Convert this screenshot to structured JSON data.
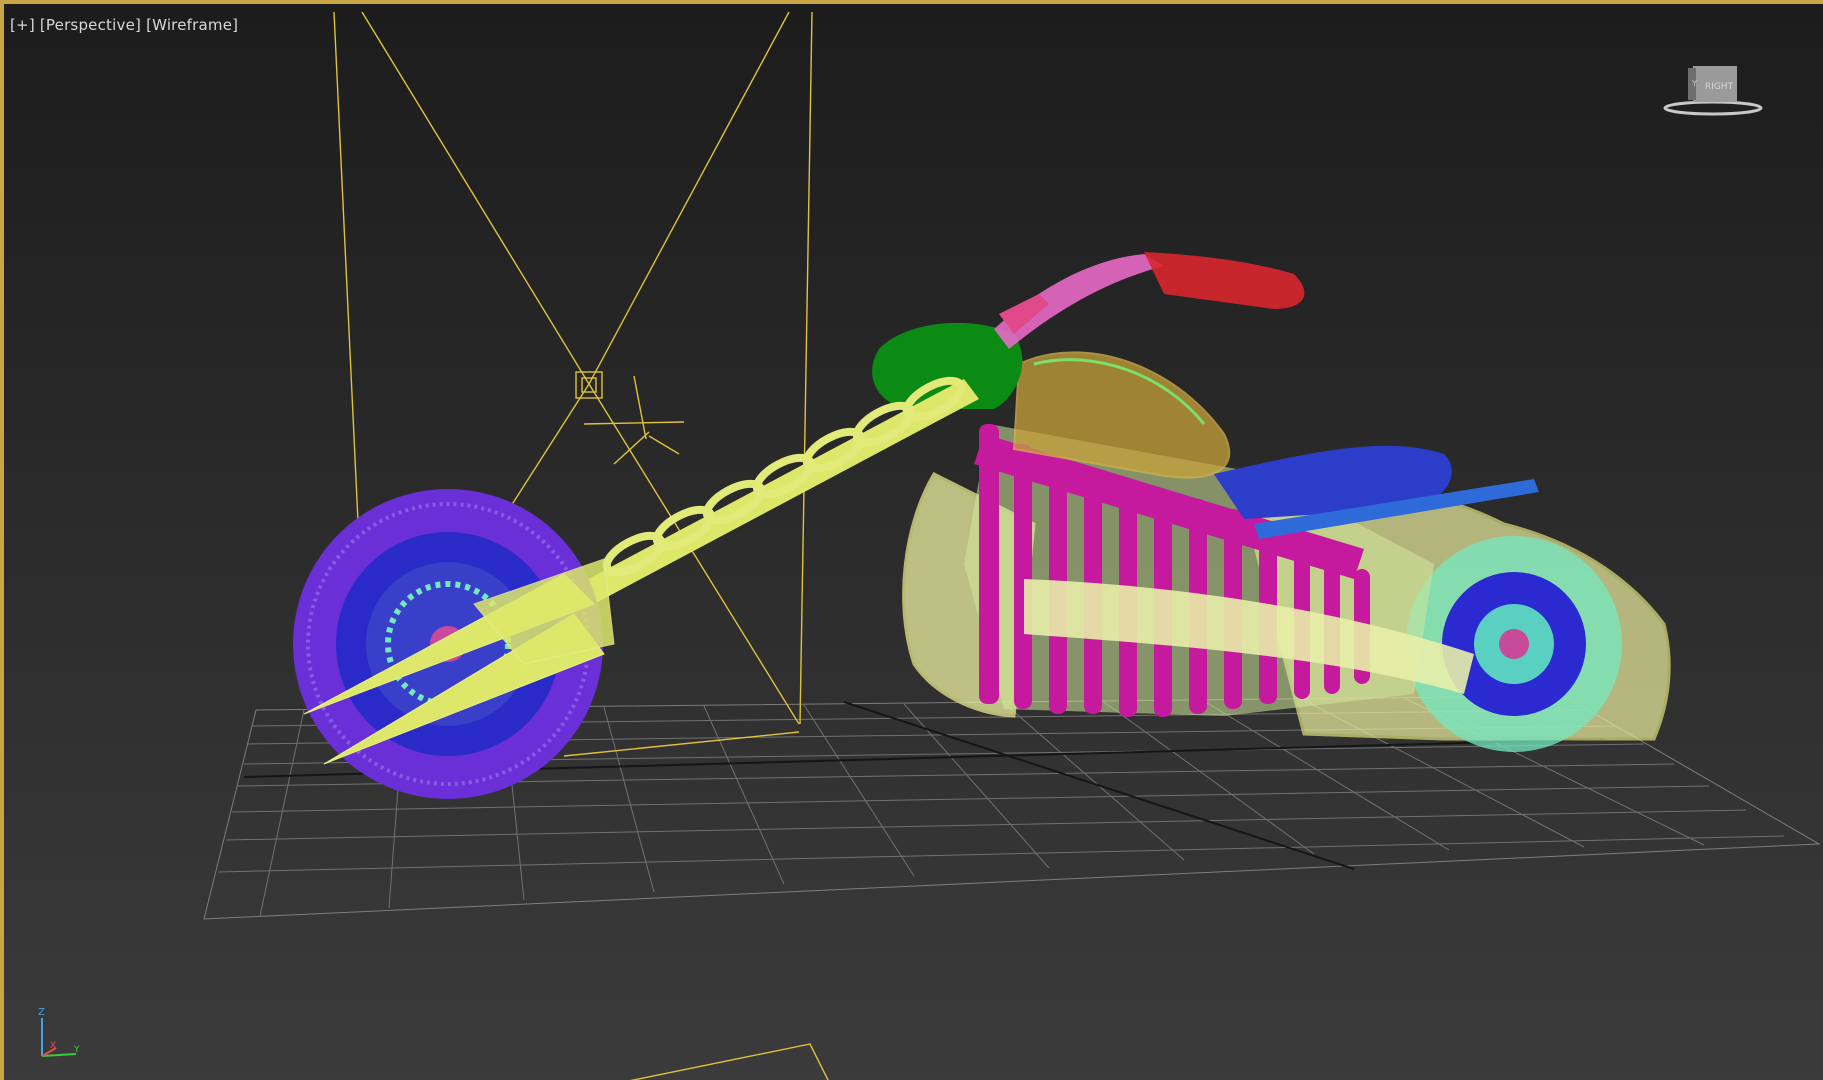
{
  "viewport": {
    "label_plus": "[+]",
    "label_view": "[Perspective]",
    "label_mode": "[Wireframe]"
  },
  "viewcube": {
    "face_label": "RIGHT",
    "corner_label": "Y"
  },
  "axis_tripod": {
    "z_label": "Z",
    "x_label": "X",
    "y_label": "Y"
  },
  "colors": {
    "viewport_border": "#c8a646",
    "grid": "#8a8a8a",
    "light_helper": "#e0c23a",
    "front_tire": "#6a2fd6",
    "front_rim": "#2a2ac8",
    "fork": "#dde86a",
    "frame_skeleton": "#c61a9e",
    "flame_fringe": "#eef0a0",
    "tank_green": "#0b8a14",
    "handlebar_red": "#d8262e",
    "handlebar_pink": "#e86ac8",
    "seat_blue": "#2b3dc9",
    "rear_wheel": "#74e8c0"
  },
  "icons": [
    "viewcube-icon",
    "axis-tripod-icon",
    "light-target-icon"
  ]
}
